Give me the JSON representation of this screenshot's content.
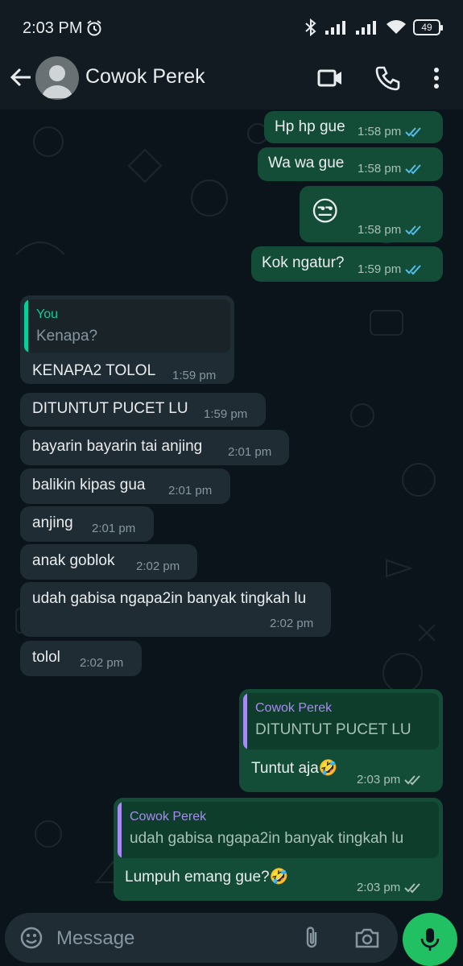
{
  "status_bar": {
    "time": "2:03 PM",
    "battery": "49"
  },
  "contact": {
    "name": "Cowok Perek"
  },
  "messages": [
    {
      "text": "Hp hp gue",
      "time": "1:58 pm"
    },
    {
      "text": "Wa wa gue",
      "time": "1:58 pm"
    },
    {
      "text": "😒",
      "time": "1:58 pm"
    },
    {
      "text": "Kok ngatur?",
      "time": "1:59 pm"
    },
    {
      "quote_author": "You",
      "quote_text": "Kenapa?",
      "text": "KENAPA2 TOLOL",
      "time": "1:59 pm"
    },
    {
      "text": "DITUNTUT PUCET LU",
      "time": "1:59 pm"
    },
    {
      "text": "bayarin bayarin tai anjing",
      "time": "2:01 pm"
    },
    {
      "text": "balikin kipas gua",
      "time": "2:01 pm"
    },
    {
      "text": "anjing",
      "time": "2:01 pm"
    },
    {
      "text": "anak goblok",
      "time": "2:02 pm"
    },
    {
      "text": "udah gabisa ngapa2in banyak tingkah lu",
      "time": "2:02 pm"
    },
    {
      "text": "tolol",
      "time": "2:02 pm"
    },
    {
      "quote_author": "Cowok Perek",
      "quote_text": "DITUNTUT PUCET LU",
      "text": "Tuntut aja🤣",
      "time": "2:03 pm"
    },
    {
      "quote_author": "Cowok Perek",
      "quote_text": "udah gabisa ngapa2in banyak tingkah lu",
      "text": "Lumpuh emang gue?🤣",
      "time": "2:03 pm"
    }
  ],
  "input": {
    "placeholder": "Message"
  },
  "icons": {
    "back": "arrow-left-icon",
    "video_call": "video-icon",
    "voice_call": "phone-icon",
    "menu": "more-vert-icon",
    "emoji": "emoji-icon",
    "attach": "paperclip-icon",
    "camera": "camera-icon",
    "mic": "mic-icon",
    "read": "double-check-blue",
    "delivered": "double-check-gray"
  },
  "colors": {
    "outgoing_bubble": "#144d37",
    "incoming_bubble": "#202c33",
    "accent_green": "#21c063",
    "read_tick": "#53bdeb",
    "quote_you": "#06cf9c",
    "quote_contact": "#a68bf0"
  }
}
